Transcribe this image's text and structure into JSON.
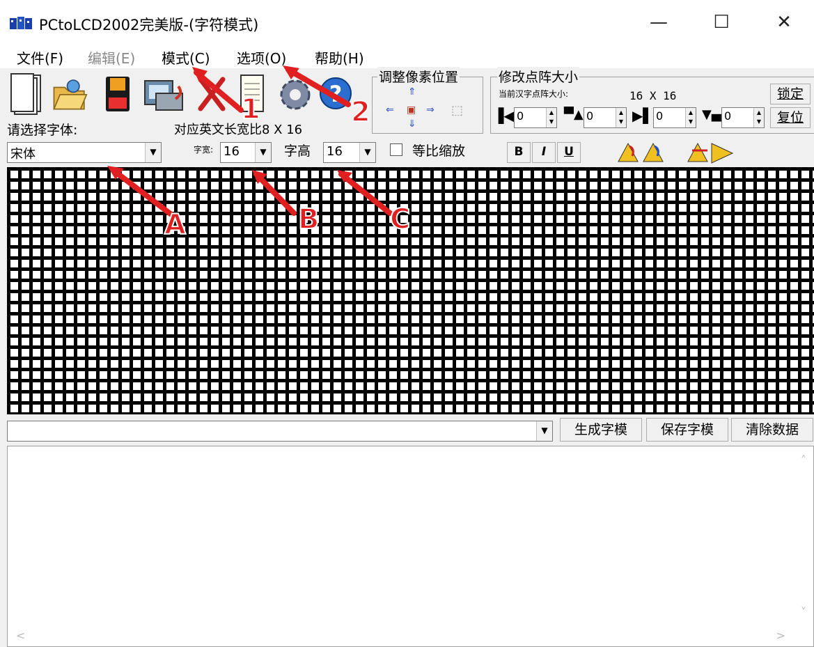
{
  "window": {
    "title": "PCtoLCD2002完美版-(字符模式)",
    "minimize_glyph": "—",
    "maximize_glyph": "☐",
    "close_glyph": "✕"
  },
  "menu": [
    {
      "label": "文件(F)",
      "enabled": true
    },
    {
      "label": "编辑(E)",
      "enabled": false
    },
    {
      "label": "模式(C)",
      "enabled": true
    },
    {
      "label": "选项(O)",
      "enabled": true
    },
    {
      "label": "帮助(H)",
      "enabled": true
    }
  ],
  "toolbar": {
    "icons": [
      "new-document-icon",
      "open-folder-icon",
      "save-disk-icon",
      "import-image-icon",
      "cut-icon",
      "notepad-icon",
      "settings-gear-icon",
      "help-icon"
    ]
  },
  "pixel_position": {
    "title": "调整像素位置"
  },
  "matrix_size": {
    "title": "修改点阵大小",
    "current_label": "当前汉字点阵大小:",
    "current_value": "16 X 16",
    "lock_label": "锁定",
    "reset_label": "复位",
    "spins": [
      "0",
      "0",
      "0",
      "0"
    ]
  },
  "font": {
    "select_label": "请选择字体:",
    "ratio_label": "对应英文长宽比8 X 16",
    "font_name": "宋体",
    "width_label": "字宽:",
    "width_value": "16",
    "height_label": "字高",
    "height_value": "16",
    "proportional_label": "等比缩放",
    "bold": "B",
    "italic": "I",
    "underline": "U"
  },
  "output": {
    "input_value": "",
    "generate_label": "生成字模",
    "save_label": "保存字模",
    "clear_label": "清除数据"
  },
  "annotations": {
    "n1": "1",
    "n2": "2",
    "a": "A",
    "b": "B",
    "c": "C",
    "color": "#e02020"
  }
}
